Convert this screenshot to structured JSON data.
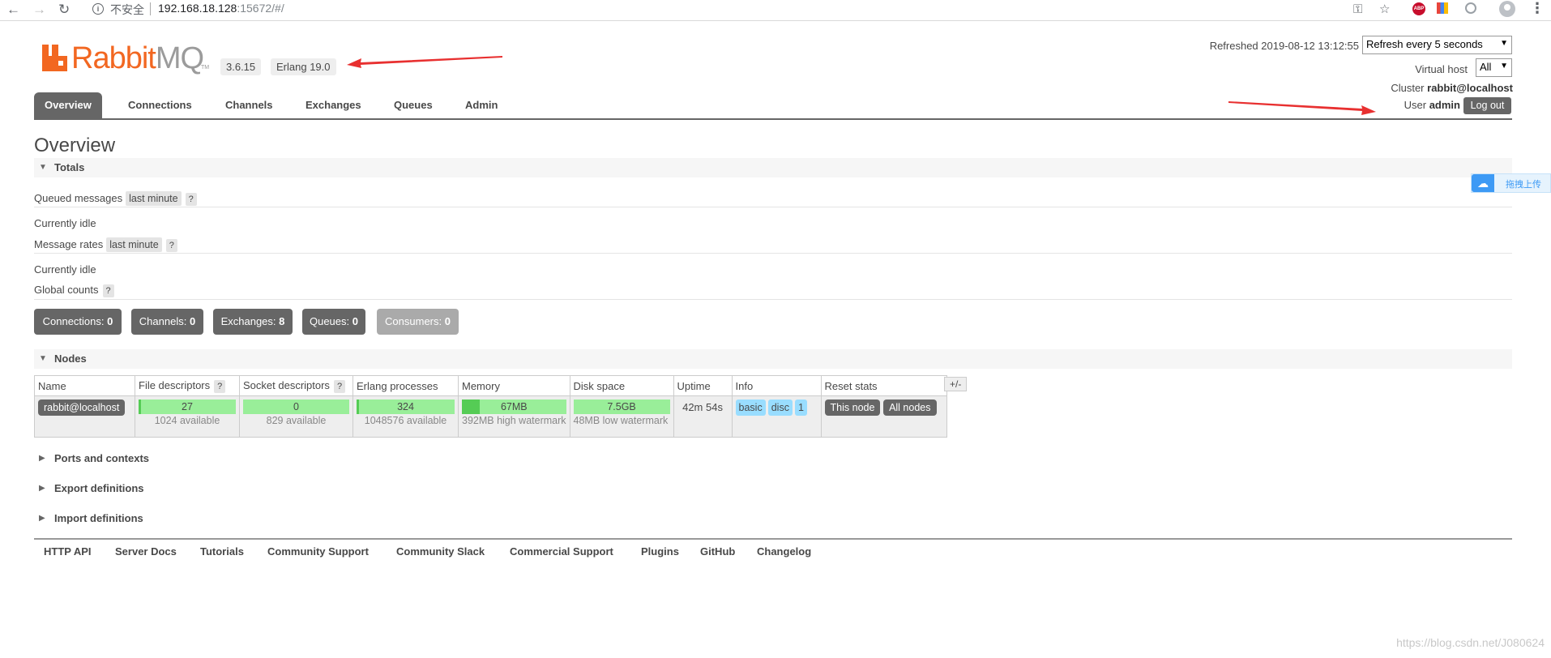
{
  "browser": {
    "back_icon": "←",
    "forward_icon": "→",
    "reload_icon": "↻",
    "security_label": "不安全",
    "url_host": "192.168.18.128",
    "url_rest": ":15672/#/",
    "key_icon": "⚿",
    "star_icon": "☆",
    "abp_label": "ABP",
    "menu_icon": "⋮"
  },
  "header": {
    "logo_rabbit": "Rabbit",
    "logo_mq": "MQ",
    "logo_tm": "TM",
    "version": "3.6.15",
    "erlang": "Erlang 19.0",
    "refreshed": "Refreshed 2019-08-12 13:12:55",
    "refresh_select": "Refresh every 5 seconds",
    "vhost_label": "Virtual host",
    "vhost_value": "All",
    "cluster_label": "Cluster",
    "cluster_value": "rabbit@localhost",
    "user_label": "User",
    "user_value": "admin",
    "logout": "Log out"
  },
  "tabs": [
    "Overview",
    "Connections",
    "Channels",
    "Exchanges",
    "Queues",
    "Admin"
  ],
  "page_title": "Overview",
  "totals": {
    "heading": "Totals",
    "queued_label": "Queued messages",
    "queued_range": "last minute",
    "help": "?",
    "idle1": "Currently idle",
    "rates_label": "Message rates",
    "rates_range": "last minute",
    "idle2": "Currently idle",
    "global_label": "Global counts"
  },
  "counts": [
    {
      "label": "Connections:",
      "value": "0"
    },
    {
      "label": "Channels:",
      "value": "0"
    },
    {
      "label": "Exchanges:",
      "value": "8"
    },
    {
      "label": "Queues:",
      "value": "0"
    },
    {
      "label": "Consumers:",
      "value": "0"
    }
  ],
  "nodes": {
    "heading": "Nodes",
    "columns": [
      "Name",
      "File descriptors",
      "Socket descriptors",
      "Erlang processes",
      "Memory",
      "Disk space",
      "Uptime",
      "Info",
      "Reset stats"
    ],
    "plusminus": "+/-",
    "row": {
      "name": "rabbit@localhost",
      "fd_value": "27",
      "fd_sub": "1024 available",
      "fd_fraction": 0.026,
      "sd_value": "0",
      "sd_sub": "829 available",
      "sd_fraction": 0,
      "ep_value": "324",
      "ep_sub": "1048576 available",
      "ep_fraction": 0.0003,
      "mem_value": "67MB",
      "mem_sub": "392MB high watermark",
      "mem_fraction": 0.17,
      "disk_value": "7.5GB",
      "disk_sub": "48MB low watermark",
      "uptime": "42m 54s",
      "info": [
        "basic",
        "disc",
        "1"
      ],
      "reset_this": "This node",
      "reset_all": "All nodes"
    }
  },
  "collapsed_sections": [
    "Ports and contexts",
    "Export definitions",
    "Import definitions"
  ],
  "footer": [
    "HTTP API",
    "Server Docs",
    "Tutorials",
    "Community Support",
    "Community Slack",
    "Commercial Support",
    "Plugins",
    "GitHub",
    "Changelog"
  ],
  "float_widget": {
    "label": "拖拽上传"
  },
  "watermark": "https://blog.csdn.net/J080624",
  "colors": {
    "brand": "#f26721",
    "annotation_arrow": "#e83030",
    "bar": "#99ee99",
    "tab": "#666666"
  }
}
